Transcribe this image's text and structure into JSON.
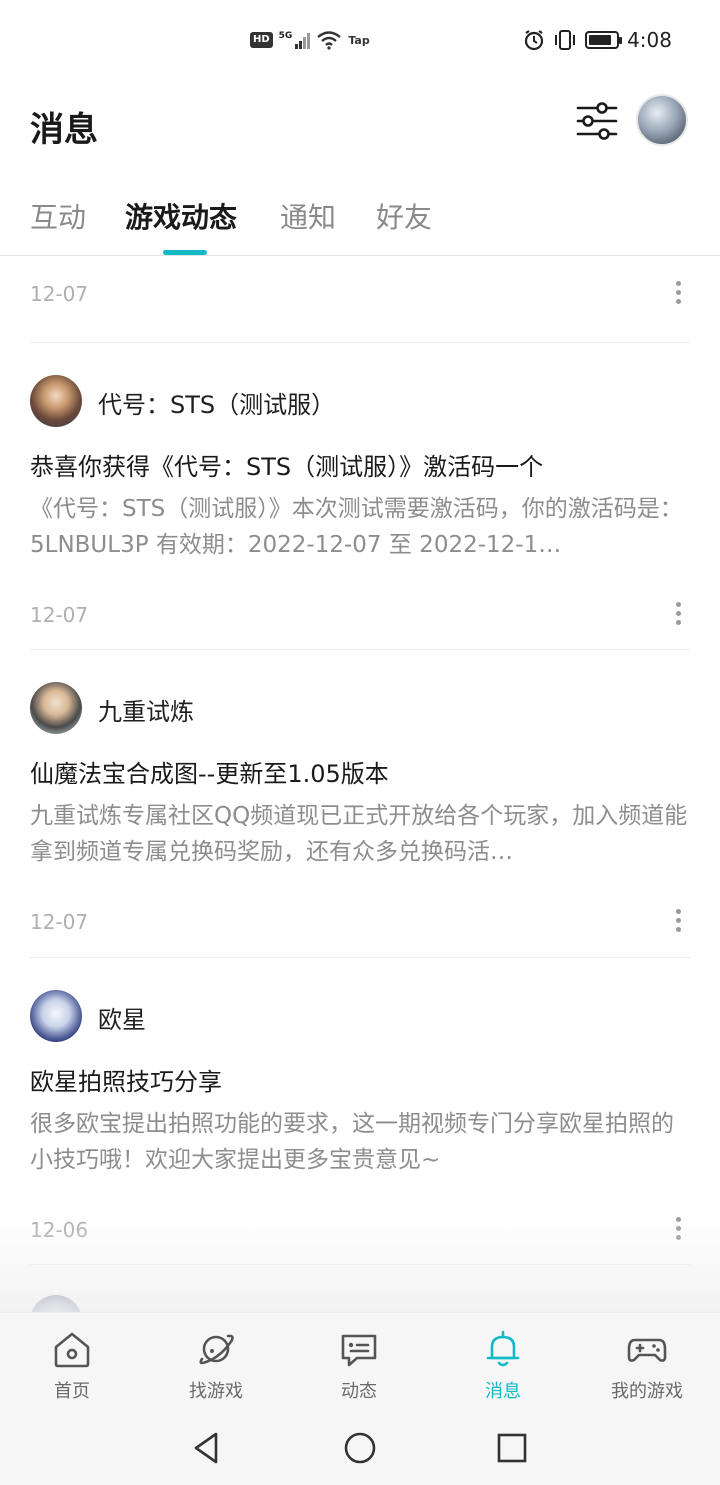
{
  "status_bar": {
    "hd": "HD",
    "net": "5G",
    "tap": "Tap",
    "time": "4:08",
    "battery_level": 0.85
  },
  "header": {
    "title": "消息"
  },
  "tabs": [
    {
      "label": "互动",
      "active": false
    },
    {
      "label": "游戏动态",
      "active": true
    },
    {
      "label": "通知",
      "active": false
    },
    {
      "label": "好友",
      "active": false
    }
  ],
  "feed": {
    "first_date": "12-07",
    "items": [
      {
        "game": "代号：STS（测试服）",
        "title": "恭喜你获得《代号：STS（测试服）》激活码一个",
        "body": "《代号：STS（测试服）》本次测试需要激活码，你的激活码是：5LNBUL3P 有效期：2022-12-07 至 2022-12-1…",
        "date": "12-07"
      },
      {
        "game": "九重试炼",
        "title": "仙魔法宝合成图--更新至1.05版本",
        "body": "九重试炼专属社区QQ频道现已正式开放给各个玩家，加入频道能拿到频道专属兑换码奖励，还有众多兑换码活…",
        "date": "12-07"
      },
      {
        "game": "欧星",
        "title": "欧星拍照技巧分享",
        "body": "很多欧宝提出拍照功能的要求，这一期视频专门分享欧星拍照的小技巧哦！欢迎大家提出更多宝贵意见~",
        "date": "12-06"
      }
    ]
  },
  "bottom_nav": [
    {
      "label": "首页",
      "icon": "home-icon",
      "active": false
    },
    {
      "label": "找游戏",
      "icon": "planet-icon",
      "active": false
    },
    {
      "label": "动态",
      "icon": "chat-icon",
      "active": false
    },
    {
      "label": "消息",
      "icon": "bell-icon",
      "active": true
    },
    {
      "label": "我的游戏",
      "icon": "gamepad-icon",
      "active": false
    }
  ],
  "colors": {
    "accent": "#14b9c8",
    "text_primary": "#1a1a1a",
    "text_secondary": "#8d8d8d",
    "date": "#b0b0b0"
  }
}
